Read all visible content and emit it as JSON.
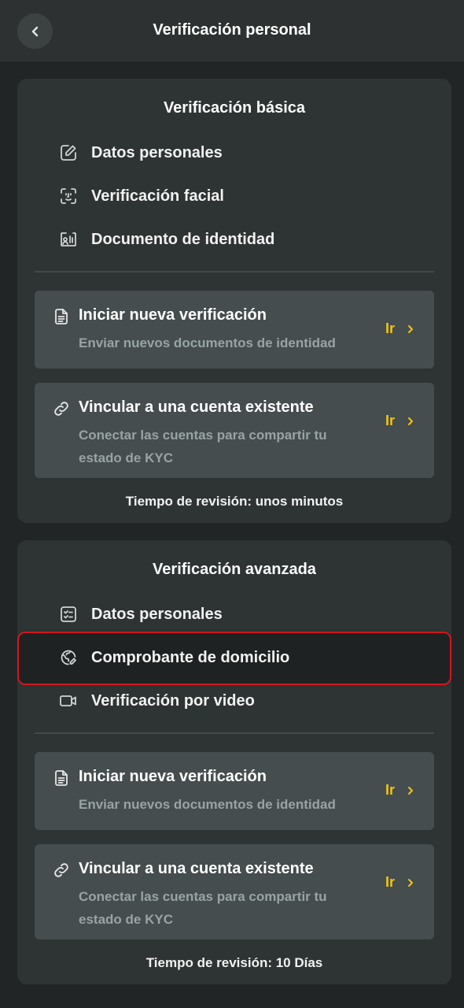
{
  "header": {
    "title": "Verificación personal",
    "back_icon": "chevron-left-icon"
  },
  "basic": {
    "title": "Verificación básica",
    "steps": [
      {
        "label": "Datos personales",
        "icon": "edit-square-icon"
      },
      {
        "label": "Verificación facial",
        "icon": "face-scan-icon"
      },
      {
        "label": "Documento de identidad",
        "icon": "id-card-icon"
      }
    ],
    "options": [
      {
        "title": "Iniciar nueva verificación",
        "subtitle": "Enviar nuevos documentos de identidad",
        "action": "Ir",
        "icon": "document-icon"
      },
      {
        "title": "Vincular a una cuenta existente",
        "subtitle": "Conectar las cuentas para compartir tu estado de KYC",
        "action": "Ir",
        "icon": "link-icon"
      }
    ],
    "review_time": "Tiempo de revisión: unos minutos"
  },
  "advanced": {
    "title": "Verificación avanzada",
    "steps": [
      {
        "label": "Datos personales",
        "icon": "checklist-icon"
      },
      {
        "label": "Comprobante de domicilio",
        "icon": "globe-edit-icon"
      },
      {
        "label": "Verificación por video",
        "icon": "video-camera-icon"
      }
    ],
    "options": [
      {
        "title": "Iniciar nueva verificación",
        "subtitle": "Enviar nuevos documentos de identidad",
        "action": "Ir",
        "icon": "document-icon"
      },
      {
        "title": "Vincular a una cuenta existente",
        "subtitle": "Conectar las cuentas para compartir tu estado de KYC",
        "action": "Ir",
        "icon": "link-icon"
      }
    ],
    "review_time": "Tiempo de revisión: 10 Días"
  },
  "colors": {
    "accent": "#f0c417",
    "highlight_border": "#d3161d",
    "card_bg": "#2e3333",
    "option_bg": "#454d4e"
  }
}
